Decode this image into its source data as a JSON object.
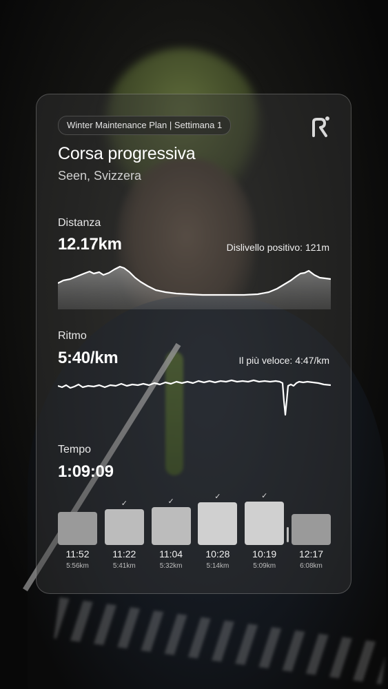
{
  "plan_badge": "Winter Maintenance Plan | Settimana 1",
  "workout": {
    "title": "Corsa progressiva",
    "location": "Seen, Svizzera"
  },
  "distance": {
    "label": "Distanza",
    "value": "12.17km",
    "elevation_text": "Dislivello positivo: 121m"
  },
  "pace": {
    "label": "Ritmo",
    "value": "5:40/km",
    "fastest_text": "Il più veloce: 4:47/km"
  },
  "time": {
    "label": "Tempo",
    "value": "1:09:09"
  },
  "splits": [
    {
      "time": "11:52",
      "pace": "5:56km",
      "checked": false,
      "level": 0.66
    },
    {
      "time": "11:22",
      "pace": "5:41km",
      "checked": true,
      "level": 0.72
    },
    {
      "time": "11:04",
      "pace": "5:32km",
      "checked": true,
      "level": 0.76
    },
    {
      "time": "10:28",
      "pace": "5:14km",
      "checked": true,
      "level": 0.86
    },
    {
      "time": "10:19",
      "pace": "5:09km",
      "checked": true,
      "level": 0.88
    },
    {
      "time": "12:17",
      "pace": "6:08km",
      "checked": false,
      "level": 0.62
    }
  ],
  "colors": {
    "card_bg": "rgba(58,58,58,0.42)",
    "bar_light": "#d0d0d0",
    "bar_mid": "#bcbcbc",
    "bar_dark": "#9a9a9a"
  },
  "icons": {
    "logo": "runna-logo-icon",
    "check": "check-icon"
  }
}
